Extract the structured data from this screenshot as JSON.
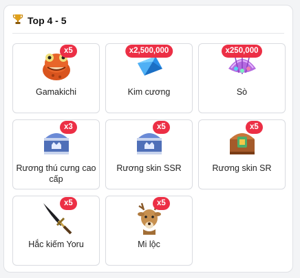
{
  "panel": {
    "title": "Top 4 - 5",
    "title_icon": "trophy-icon"
  },
  "rewards": [
    {
      "name": "Gamakichi",
      "qty": "x5",
      "icon": "toad-icon"
    },
    {
      "name": "Kim cương",
      "qty": "x2,500,000",
      "icon": "diamond-icon"
    },
    {
      "name": "Sò",
      "qty": "x250,000",
      "icon": "shell-icon"
    },
    {
      "name": "Rương thú cưng cao cấp",
      "qty": "x3",
      "icon": "pet-chest-icon"
    },
    {
      "name": "Rương skin SSR",
      "qty": "x5",
      "icon": "ssr-chest-icon"
    },
    {
      "name": "Rương skin SR",
      "qty": "x5",
      "icon": "sr-chest-icon"
    },
    {
      "name": "Hắc kiếm Yoru",
      "qty": "x5",
      "icon": "black-sword-icon"
    },
    {
      "name": "Mi lộc",
      "qty": "x5",
      "icon": "deer-icon"
    }
  ],
  "colors": {
    "badge": "#ec2f45",
    "border": "#d9dbe0"
  }
}
